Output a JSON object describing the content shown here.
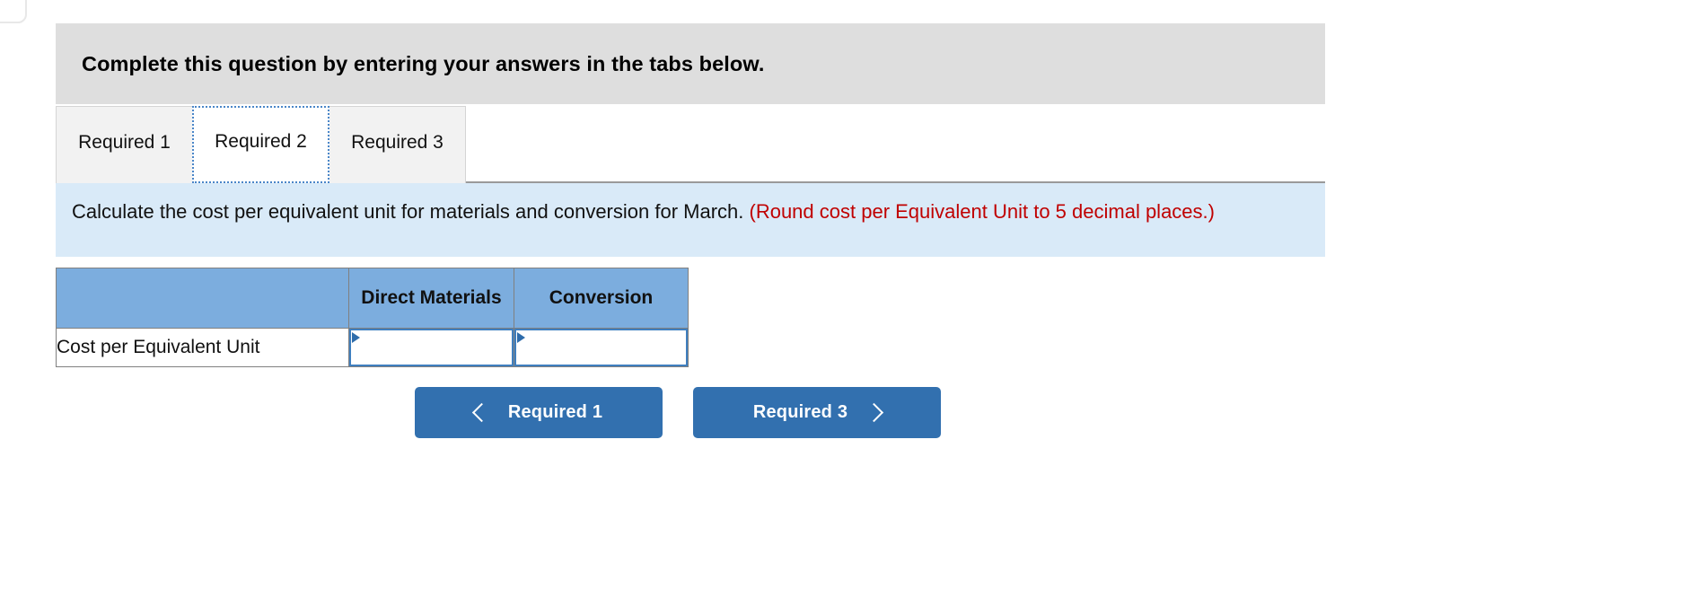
{
  "banner": {
    "title": "Complete this question by entering your answers in the tabs below."
  },
  "tabs": {
    "items": [
      {
        "label": "Required 1",
        "active": false
      },
      {
        "label": "Required 2",
        "active": true
      },
      {
        "label": "Required 3",
        "active": false
      }
    ]
  },
  "requirement": {
    "text_main": "Calculate the cost per equivalent unit for materials and conversion for March. ",
    "text_note": "(Round cost per Equivalent Unit to 5 decimal places.)"
  },
  "answer_table": {
    "headers": [
      "",
      "Direct Materials",
      "Conversion"
    ],
    "rows": [
      {
        "label": "Cost per Equivalent Unit",
        "direct_materials": "",
        "conversion": "",
        "placeholder": ""
      }
    ]
  },
  "navigation": {
    "prev_label": "Required 1",
    "next_label": "Required 3",
    "prev_icon": "chevron-left-icon",
    "next_icon": "chevron-right-icon"
  },
  "colors": {
    "banner_bg": "#dedede",
    "requirement_bg": "#d9eaf8",
    "note_red": "#c00000",
    "table_header_blue": "#7cadde",
    "input_border_blue": "#3f7fbf",
    "button_blue": "#3270af",
    "active_tab_border": "#4a86c8"
  }
}
